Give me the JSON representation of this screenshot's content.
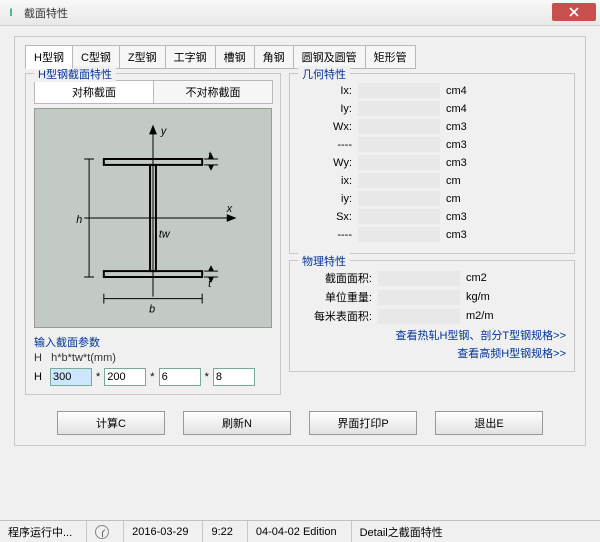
{
  "window": {
    "title": "截面特性"
  },
  "tabs": [
    "H型钢",
    "C型钢",
    "Z型钢",
    "工字钢",
    "槽钢",
    "角钢",
    "圆钢及圆管",
    "矩形管"
  ],
  "section": {
    "group_label": "H型钢截面特性",
    "sym_tabs": [
      "对称截面",
      "不对称截面"
    ],
    "param_group_label": "输入截面参数",
    "param_hint_label": "H",
    "param_hint": "h*b*tw*t(mm)",
    "param_row_label": "H",
    "params": {
      "h": "300",
      "b": "200",
      "tw": "6",
      "t": "8"
    }
  },
  "geom": {
    "group_label": "几何特性",
    "rows": [
      {
        "label": "Ix:",
        "unit": "cm4"
      },
      {
        "label": "Iy:",
        "unit": "cm4"
      },
      {
        "label": "Wx:",
        "unit": "cm3"
      },
      {
        "label": "----",
        "unit": "cm3"
      },
      {
        "label": "Wy:",
        "unit": "cm3"
      },
      {
        "label": "ix:",
        "unit": "cm"
      },
      {
        "label": "iy:",
        "unit": "cm"
      },
      {
        "label": "Sx:",
        "unit": "cm3"
      },
      {
        "label": "----",
        "unit": "cm3"
      }
    ]
  },
  "phys": {
    "group_label": "物理特性",
    "rows": [
      {
        "label": "截面面积:",
        "unit": "cm2"
      },
      {
        "label": "单位重量:",
        "unit": "kg/m"
      },
      {
        "label": "每米表面积:",
        "unit": "m2/m"
      }
    ],
    "link1": "查看热轧H型钢、剖分T型钢规格>>",
    "link2": "查看高频H型钢规格>>"
  },
  "buttons": {
    "calc": "计算C",
    "refresh": "刷新N",
    "print": "界面打印P",
    "exit": "退出E"
  },
  "status": {
    "running": "程序运行中...",
    "date": "2016-03-29",
    "time": "9:22",
    "edition": "04-04-02 Edition",
    "detail": "Detail之截面特性"
  },
  "diagram_labels": {
    "y": "y",
    "x": "x",
    "h": "h",
    "b": "b",
    "tw": "tw",
    "t1": "t",
    "t2": "t"
  }
}
